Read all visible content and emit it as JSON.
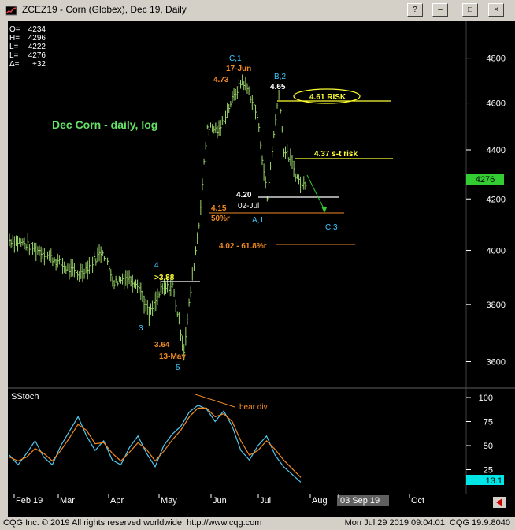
{
  "window": {
    "title": "ZCEZ19 - Corn (Globex), Dec 19, Daily",
    "buttons": [
      "?",
      "–",
      "□",
      "×"
    ]
  },
  "ohlc_box": [
    {
      "label": "O=",
      "value": "4234"
    },
    {
      "label": "H=",
      "value": "4296"
    },
    {
      "label": "L=",
      "value": "4222"
    },
    {
      "label": "L=",
      "value": "4276"
    },
    {
      "label": "Δ=",
      "value": "+32"
    }
  ],
  "status": {
    "left": "CQG Inc. © 2019 All rights reserved worldwide. http://www.cqg.com",
    "right": "Mon Jul 29 2019 09:04:01, CQG 19.9.8040"
  },
  "colors": {
    "price": "#9dd86a",
    "green_text": "#66e066",
    "orange": "#f08a24",
    "yellow": "#ffff33",
    "cyan": "#3cc8ff",
    "white": "#ffffff",
    "stoch_k": "#4fc8f0",
    "stoch_d": "#f08a24",
    "last_price_box": "#33cc33",
    "stoch_box": "#00e5e5"
  },
  "chart_data": [
    {
      "type": "line",
      "title": "Dec Corn - daily, log",
      "y_axis": {
        "ticks": [
          3600,
          3800,
          4000,
          4200,
          4400,
          4600,
          4800
        ],
        "range": [
          3540,
          4900
        ],
        "scale": "log"
      },
      "x_axis": {
        "labels": [
          "Feb 19",
          "Mar",
          "Apr",
          "May",
          "Jun",
          "Jul",
          "Aug",
          "03 Sep 19",
          "Oct"
        ]
      },
      "last_price": "4276",
      "series": [
        {
          "name": "",
          "x": [
            "2019-01-28",
            "2019-02-04",
            "2019-02-11",
            "2019-02-18",
            "2019-02-25",
            "2019-03-04",
            "2019-03-11",
            "2019-03-18",
            "2019-03-25",
            "2019-04-01",
            "2019-04-08",
            "2019-04-15",
            "2019-04-22",
            "2019-04-29",
            "2019-05-06",
            "2019-05-13",
            "2019-05-17",
            "2019-05-22",
            "2019-05-27",
            "2019-06-03",
            "2019-06-10",
            "2019-06-17",
            "2019-06-21",
            "2019-06-26",
            "2019-07-02",
            "2019-07-05",
            "2019-07-09",
            "2019-07-12",
            "2019-07-16",
            "2019-07-19",
            "2019-07-23",
            "2019-07-26"
          ],
          "y": [
            4040,
            4030,
            4010,
            3990,
            3960,
            3930,
            3910,
            3950,
            4000,
            3880,
            3900,
            3880,
            3760,
            3850,
            3870,
            3640,
            3850,
            4100,
            4500,
            4480,
            4600,
            4700,
            4650,
            4540,
            4200,
            4400,
            4650,
            4400,
            4360,
            4300,
            4250,
            4276
          ]
        }
      ],
      "annotations": [
        {
          "text": "C,1",
          "value": "",
          "color": "cyan"
        },
        {
          "text": "17-Jun",
          "value": "",
          "color": "orange"
        },
        {
          "text": "4.73",
          "value": "",
          "color": "orange"
        },
        {
          "text": "B,2",
          "value": "",
          "color": "cyan"
        },
        {
          "text": "4.65",
          "value": "",
          "color": "white"
        },
        {
          "text": "4.61 RISK",
          "value": "4610",
          "color": "yellow"
        },
        {
          "text": "4.37 s-t risk",
          "value": "4370",
          "color": "yellow"
        },
        {
          "text": "4.20",
          "value": "4200",
          "color": "white"
        },
        {
          "text": "02-Jul",
          "value": "",
          "color": "white"
        },
        {
          "text": "4.15",
          "value": "4150",
          "color": "orange"
        },
        {
          "text": "50%r",
          "value": "",
          "color": "orange"
        },
        {
          "text": "A,1",
          "value": "",
          "color": "cyan"
        },
        {
          "text": "C,3",
          "value": "",
          "color": "cyan"
        },
        {
          "text": "4.02 - 61.8%r",
          "value": "4020",
          "color": "orange"
        },
        {
          "text": "4",
          "value": "",
          "color": "cyan"
        },
        {
          "text": ">3.88",
          "value": "3880",
          "color": "yellow"
        },
        {
          "text": "3",
          "value": "",
          "color": "cyan"
        },
        {
          "text": "3.64",
          "value": "",
          "color": "orange"
        },
        {
          "text": "13-May",
          "value": "",
          "color": "orange"
        },
        {
          "text": "5",
          "value": "",
          "color": "cyan"
        }
      ]
    },
    {
      "type": "line",
      "title": "SStoch",
      "y_axis": {
        "ticks": [
          25,
          50,
          75,
          100
        ],
        "range": [
          0,
          100
        ]
      },
      "last_value": "13.1",
      "annotations": [
        {
          "text": "bear div",
          "color": "orange"
        }
      ],
      "series": [
        {
          "name": "",
          "y": [
            40,
            30,
            42,
            55,
            38,
            30,
            50,
            65,
            80,
            60,
            45,
            55,
            35,
            30,
            48,
            60,
            42,
            28,
            50,
            62,
            70,
            85,
            92,
            88,
            75,
            86,
            70,
            45,
            35,
            50,
            60,
            40,
            28,
            20,
            12
          ]
        },
        {
          "name": "",
          "y": [
            38,
            34,
            38,
            47,
            42,
            34,
            45,
            58,
            72,
            66,
            52,
            53,
            42,
            34,
            43,
            53,
            46,
            34,
            44,
            56,
            66,
            80,
            89,
            89,
            80,
            83,
            75,
            55,
            40,
            45,
            55,
            46,
            35,
            26,
            17
          ]
        }
      ]
    }
  ]
}
